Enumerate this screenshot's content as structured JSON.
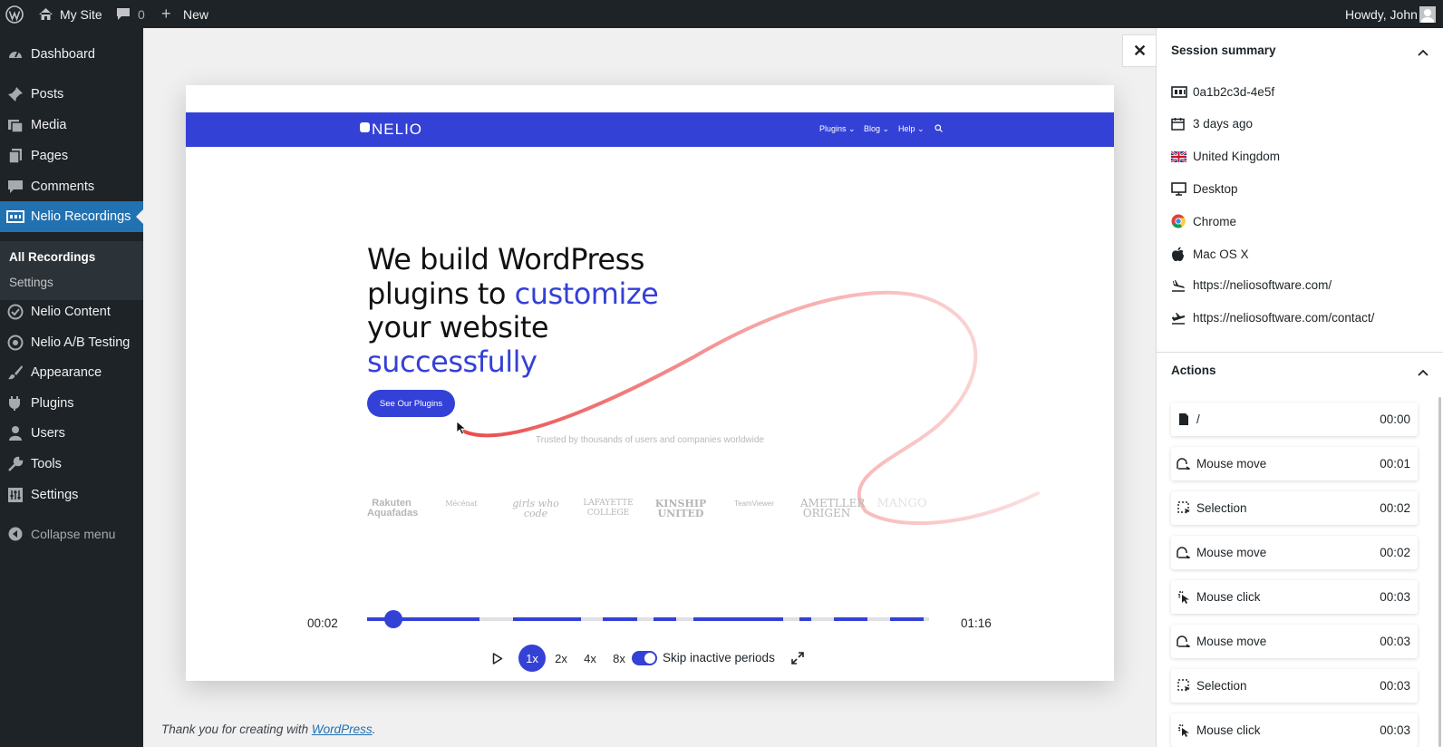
{
  "admin_bar": {
    "site_name": "My Site",
    "comments_count": "0",
    "new_label": "New",
    "greeting": "Howdy, John"
  },
  "sidebar": {
    "items": [
      {
        "label": "Dashboard",
        "icon": "dashboard-icon"
      },
      {
        "label": "Posts",
        "icon": "pushpin-icon"
      },
      {
        "label": "Media",
        "icon": "media-icon"
      },
      {
        "label": "Pages",
        "icon": "pages-icon"
      },
      {
        "label": "Comments",
        "icon": "comment-icon"
      },
      {
        "label": "Nelio Recordings",
        "icon": "recordings-icon",
        "current": true
      },
      {
        "label": "Nelio Content",
        "icon": "nelio-content-icon"
      },
      {
        "label": "Nelio A/B Testing",
        "icon": "ab-testing-icon"
      },
      {
        "label": "Appearance",
        "icon": "brush-icon"
      },
      {
        "label": "Plugins",
        "icon": "plug-icon"
      },
      {
        "label": "Users",
        "icon": "user-icon"
      },
      {
        "label": "Tools",
        "icon": "wrench-icon"
      },
      {
        "label": "Settings",
        "icon": "settings-icon"
      }
    ],
    "submenu": [
      {
        "label": "All Recordings",
        "active": true
      },
      {
        "label": "Settings",
        "active": false
      }
    ],
    "collapse_label": "Collapse menu"
  },
  "recording": {
    "site_nav": {
      "logo_text": "NELIO",
      "links": [
        "Plugins",
        "Blog",
        "Help"
      ]
    },
    "hero": {
      "line1": "We build WordPress",
      "line2_a": "plugins to ",
      "line2_b": "customize",
      "line3": "your website",
      "line4": "successfully",
      "button": "See Our Plugins",
      "trusted": "Trusted by thousands of users and companies worldwide"
    },
    "logos": [
      "Rakuten Aquafadas",
      "Mécénat",
      "girls who code",
      "LAFAYETTE COLLEGE",
      "KINSHIP UNITED",
      "TeamViewer",
      "AMETLLER ORIGEN",
      "MANGO"
    ]
  },
  "player": {
    "current_time": "00:02",
    "total_time": "01:16",
    "progress_fraction": 0.03,
    "activity_segments": [
      [
        0.0,
        0.2
      ],
      [
        0.26,
        0.38
      ],
      [
        0.42,
        0.48
      ],
      [
        0.51,
        0.55
      ],
      [
        0.58,
        0.74
      ],
      [
        0.77,
        0.79
      ],
      [
        0.83,
        0.89
      ],
      [
        0.93,
        0.99
      ]
    ],
    "speeds": [
      "1x",
      "2x",
      "4x",
      "8x"
    ],
    "selected_speed": "1x",
    "skip_inactive_label": "Skip inactive periods",
    "skip_inactive_enabled": true
  },
  "footer": {
    "text_before": "Thank you for creating with ",
    "link_text": "WordPress",
    "text_after": "."
  },
  "panel": {
    "session_title": "Session summary",
    "session": [
      {
        "icon": "id-card-icon",
        "value": "0a1b2c3d-4e5f"
      },
      {
        "icon": "calendar-icon",
        "value": "3 days ago"
      },
      {
        "icon": "uk-flag-icon",
        "value": "United Kingdom"
      },
      {
        "icon": "desktop-icon",
        "value": "Desktop"
      },
      {
        "icon": "chrome-icon",
        "value": "Chrome"
      },
      {
        "icon": "apple-icon",
        "value": "Mac OS X"
      },
      {
        "icon": "landing-icon",
        "value": "https://neliosoftware.com/"
      },
      {
        "icon": "takeoff-icon",
        "value": "https://neliosoftware.com/contact/"
      }
    ],
    "actions_title": "Actions",
    "actions": [
      {
        "icon": "page-icon",
        "label": "/",
        "time": "00:00"
      },
      {
        "icon": "mouse-move-icon",
        "label": "Mouse move",
        "time": "00:01"
      },
      {
        "icon": "selection-icon",
        "label": "Selection",
        "time": "00:02"
      },
      {
        "icon": "mouse-move-icon",
        "label": "Mouse move",
        "time": "00:02"
      },
      {
        "icon": "mouse-click-icon",
        "label": "Mouse click",
        "time": "00:03"
      },
      {
        "icon": "mouse-move-icon",
        "label": "Mouse move",
        "time": "00:03"
      },
      {
        "icon": "selection-icon",
        "label": "Selection",
        "time": "00:03"
      },
      {
        "icon": "mouse-click-icon",
        "label": "Mouse click",
        "time": "00:03"
      }
    ]
  }
}
